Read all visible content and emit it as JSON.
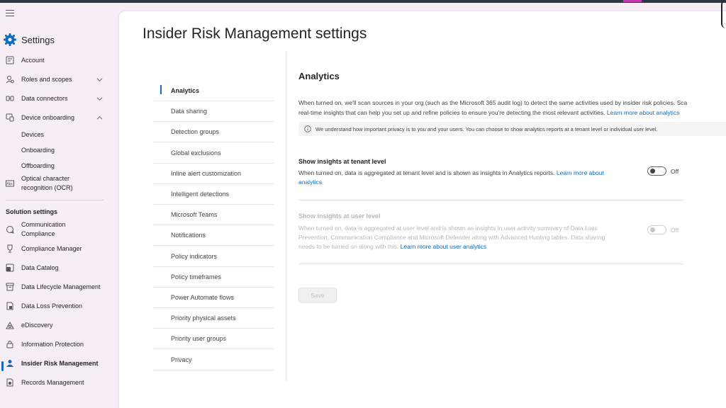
{
  "leftnav": {
    "title": "Settings",
    "items": [
      {
        "label": "Account",
        "icon": "account-icon"
      },
      {
        "label": "Roles and scopes",
        "icon": "roles-icon"
      },
      {
        "label": "Data connectors",
        "icon": "connectors-icon"
      },
      {
        "label": "Device onboarding",
        "icon": "device-icon"
      }
    ],
    "device_sub": [
      "Devices",
      "Onboarding",
      "Offboarding"
    ],
    "ocr_label_1": "Optical character",
    "ocr_label_2": "recognition (OCR)",
    "solution_label": "Solution settings",
    "solutions": [
      {
        "label": "Communication",
        "label2": "Compliance"
      },
      {
        "label": "Compliance Manager"
      },
      {
        "label": "Data Catalog"
      },
      {
        "label": "Data Lifecycle Management"
      },
      {
        "label": "Data Loss Prevention"
      },
      {
        "label": "eDiscovery"
      },
      {
        "label": "Information Protection"
      },
      {
        "label": "Insider Risk Management"
      },
      {
        "label": "Records Management"
      }
    ]
  },
  "page": {
    "title": "Insider Risk Management settings"
  },
  "subnav": [
    "Analytics",
    "Data sharing",
    "Detection groups",
    "Global exclusions",
    "Inline alert customization",
    "Intelligent detections",
    "Microsoft Teams",
    "Notifications",
    "Policy indicators",
    "Policy timeframes",
    "Power Automate flows",
    "Priority physical assets",
    "Priority user groups",
    "Privacy"
  ],
  "analytics": {
    "heading": "Analytics",
    "desc_line1": "When turned on, we'll scan sources in your org (such as the Microsoft 365 audit log) to detect the same activities used by insider risk policies. Sca",
    "desc_line2": "real-time insights that can help you set up and refine policies to ensure you're detecting the most relevant activities.",
    "desc_link": "Learn more about analytics",
    "info": "We understand how important privacy is to you and your users. You can choose to show analytics reports at a tenant level or individual user level.",
    "tenant": {
      "title": "Show insights at tenant level",
      "desc": "When turned on, data is aggregated at tenant level and is shown as insights in Analytics reports.",
      "link1": "Learn more about",
      "link2": "analytics",
      "toggle_label": "Off"
    },
    "user": {
      "title": "Show insights at user level",
      "desc_line1": "When turned on, data is aggregated at user level and is shown as insights in user activity summary of Data Loss",
      "desc_line2": "Prevention, Communication Compliance and Microsoft Defender along with Advanced Hunting tables. Data sharing",
      "desc_line3": "needs to be turned on along with this.",
      "link": "Learn more about user analytics",
      "toggle_label": "Off"
    },
    "save_label": "Save"
  }
}
